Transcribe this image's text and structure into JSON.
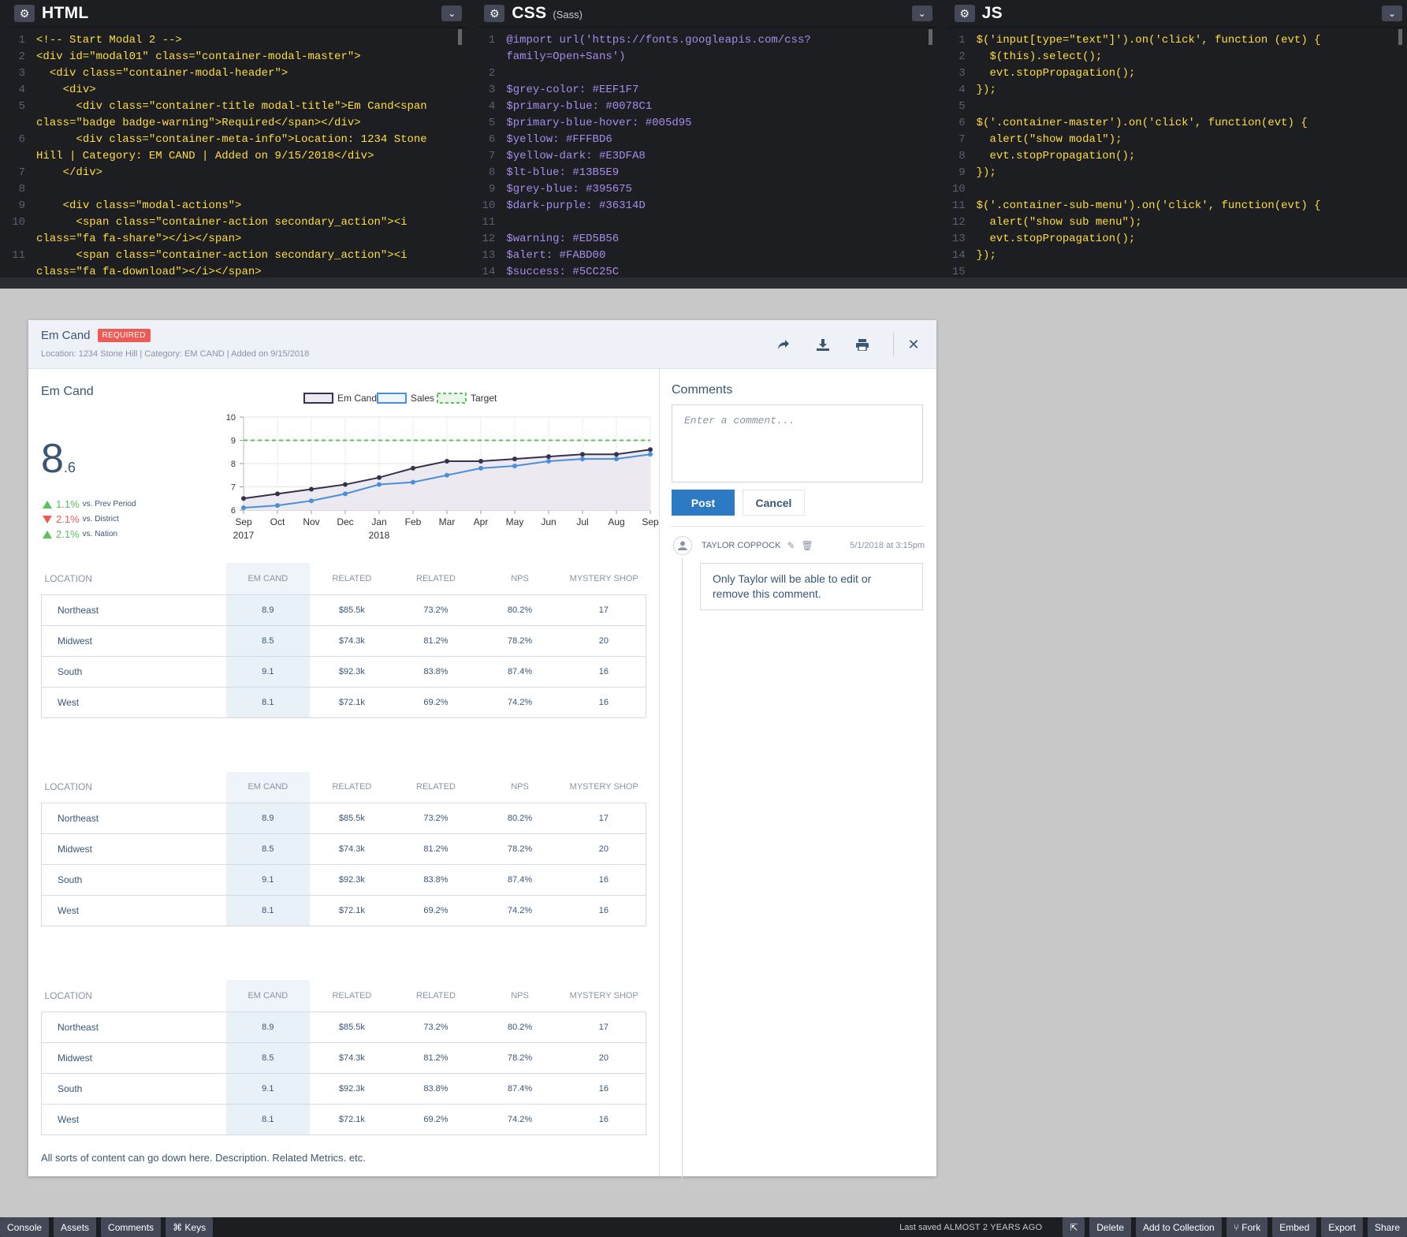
{
  "editors": {
    "html": {
      "title": "HTML",
      "lines": [
        {
          "n": "1",
          "text": "<!-- Start Modal 2 -->"
        },
        {
          "n": "2",
          "text": "<div id=\"modal01\" class=\"container-modal-master\">"
        },
        {
          "n": "3",
          "text": "  <div class=\"container-modal-header\">"
        },
        {
          "n": "4",
          "text": "    <div>"
        },
        {
          "n": "5",
          "text": "      <div class=\"container-title modal-title\">Em Cand<span class=\"badge badge-warning\">Required</span></div>"
        },
        {
          "n": "6",
          "text": "      <div class=\"container-meta-info\">Location: 1234 Stone Hill | Category: EM CAND | Added on 9/15/2018</div>"
        },
        {
          "n": "7",
          "text": "    </div>"
        },
        {
          "n": "8",
          "text": ""
        },
        {
          "n": "9",
          "text": "    <div class=\"modal-actions\">"
        },
        {
          "n": "10",
          "text": "      <span class=\"container-action secondary_action\"><i class=\"fa fa-share\"></i></span>"
        },
        {
          "n": "11",
          "text": "      <span class=\"container-action secondary_action\"><i class=\"fa fa-download\"></i></span>"
        }
      ]
    },
    "css": {
      "title": "CSS",
      "subtitle": "(Sass)",
      "lines": [
        {
          "n": "1",
          "text": "@import url('https://fonts.googleapis.com/css?family=Open+Sans')"
        },
        {
          "n": "2",
          "text": ""
        },
        {
          "n": "3",
          "text": "$grey-color: #EEF1F7"
        },
        {
          "n": "4",
          "text": "$primary-blue: #0078C1"
        },
        {
          "n": "5",
          "text": "$primary-blue-hover: #005d95"
        },
        {
          "n": "6",
          "text": "$yellow: #FFFBD6"
        },
        {
          "n": "7",
          "text": "$yellow-dark: #E3DFA8"
        },
        {
          "n": "8",
          "text": "$lt-blue: #13B5E9"
        },
        {
          "n": "9",
          "text": "$grey-blue: #395675"
        },
        {
          "n": "10",
          "text": "$dark-purple: #36314D"
        },
        {
          "n": "11",
          "text": ""
        },
        {
          "n": "12",
          "text": "$warning: #ED5B56"
        },
        {
          "n": "13",
          "text": "$alert: #FABD00"
        },
        {
          "n": "14",
          "text": "$success: #5CC25C"
        }
      ]
    },
    "js": {
      "title": "JS",
      "lines": [
        {
          "n": "1",
          "text": "$('input[type=\"text\"]').on('click', function (evt) {"
        },
        {
          "n": "2",
          "text": "  $(this).select();"
        },
        {
          "n": "3",
          "text": "  evt.stopPropagation();"
        },
        {
          "n": "4",
          "text": "});"
        },
        {
          "n": "5",
          "text": ""
        },
        {
          "n": "6",
          "text": "$('.container-master').on('click', function(evt) {"
        },
        {
          "n": "7",
          "text": "  alert(\"show modal\");"
        },
        {
          "n": "8",
          "text": "  evt.stopPropagation();"
        },
        {
          "n": "9",
          "text": "});"
        },
        {
          "n": "10",
          "text": ""
        },
        {
          "n": "11",
          "text": "$('.container-sub-menu').on('click', function(evt) {"
        },
        {
          "n": "12",
          "text": "  alert(\"show sub menu\");"
        },
        {
          "n": "13",
          "text": "  evt.stopPropagation();"
        },
        {
          "n": "14",
          "text": "});"
        },
        {
          "n": "15",
          "text": ""
        }
      ]
    }
  },
  "modal": {
    "title": "Em Cand",
    "badge": "REQUIRED",
    "meta": "Location: 1234 Stone Hill | Category: EM CAND | Added on 9/15/2018",
    "actions": [
      "share-icon",
      "download-icon",
      "print-icon",
      "close-icon"
    ],
    "metric": {
      "name": "Em Cand",
      "value_int": "8",
      "value_dec": ".6",
      "deltas": [
        {
          "dir": "up",
          "value": "1.1%",
          "label": "vs. Prev Period"
        },
        {
          "dir": "down",
          "value": "2.1%",
          "label": "vs. District"
        },
        {
          "dir": "up",
          "value": "2.1%",
          "label": "vs. Nation"
        }
      ]
    },
    "footer": "All sorts of content can go down here. Description. Related Metrics. etc."
  },
  "chart_data": {
    "type": "line",
    "categories": [
      "Sep",
      "Oct",
      "Nov",
      "Dec",
      "Jan",
      "Feb",
      "Mar",
      "Apr",
      "May",
      "Jun",
      "Jul",
      "Aug",
      "Sep"
    ],
    "category_sublabels": [
      "2017",
      "",
      "",
      "",
      "2018",
      "",
      "",
      "",
      "",
      "",
      "",
      "",
      ""
    ],
    "ylim": [
      6,
      10
    ],
    "yticks": [
      6,
      7,
      8,
      9,
      10
    ],
    "grid": true,
    "legend": "top-center",
    "series": [
      {
        "name": "Em Cand",
        "color": "#36314D",
        "fill": "#ece9f1",
        "values": [
          6.5,
          6.7,
          6.9,
          7.1,
          7.4,
          7.8,
          8.1,
          8.1,
          8.2,
          8.3,
          8.4,
          8.4,
          8.6
        ]
      },
      {
        "name": "Sales",
        "color": "#4a90d9",
        "values": [
          6.1,
          6.2,
          6.4,
          6.7,
          7.1,
          7.2,
          7.5,
          7.8,
          7.9,
          8.1,
          8.2,
          8.2,
          8.4
        ]
      },
      {
        "name": "Target",
        "color": "#5cc25c",
        "dashed": true,
        "values": [
          9,
          9,
          9,
          9,
          9,
          9,
          9,
          9,
          9,
          9,
          9,
          9,
          9
        ]
      }
    ]
  },
  "tables": [
    {
      "headers": [
        "LOCATION",
        "EM CAND",
        "RELATED",
        "RELATED",
        "NPS",
        "MYSTERY SHOP"
      ],
      "rows": [
        [
          "Northeast",
          "8.9",
          "$85.5k",
          "73.2%",
          "80.2%",
          "17"
        ],
        [
          "Midwest",
          "8.5",
          "$74.3k",
          "81.2%",
          "78.2%",
          "20"
        ],
        [
          "South",
          "9.1",
          "$92.3k",
          "83.8%",
          "87.4%",
          "16"
        ],
        [
          "West",
          "8.1",
          "$72.1k",
          "69.2%",
          "74.2%",
          "16"
        ]
      ]
    },
    {
      "headers": [
        "LOCATION",
        "EM CAND",
        "RELATED",
        "RELATED",
        "NPS",
        "MYSTERY SHOP"
      ],
      "rows": [
        [
          "Northeast",
          "8.9",
          "$85.5k",
          "73.2%",
          "80.2%",
          "17"
        ],
        [
          "Midwest",
          "8.5",
          "$74.3k",
          "81.2%",
          "78.2%",
          "20"
        ],
        [
          "South",
          "9.1",
          "$92.3k",
          "83.8%",
          "87.4%",
          "16"
        ],
        [
          "West",
          "8.1",
          "$72.1k",
          "69.2%",
          "74.2%",
          "16"
        ]
      ]
    },
    {
      "headers": [
        "LOCATION",
        "EM CAND",
        "RELATED",
        "RELATED",
        "NPS",
        "MYSTERY SHOP"
      ],
      "rows": [
        [
          "Northeast",
          "8.9",
          "$85.5k",
          "73.2%",
          "80.2%",
          "17"
        ],
        [
          "Midwest",
          "8.5",
          "$74.3k",
          "81.2%",
          "78.2%",
          "20"
        ],
        [
          "South",
          "9.1",
          "$92.3k",
          "83.8%",
          "87.4%",
          "16"
        ],
        [
          "West",
          "8.1",
          "$72.1k",
          "69.2%",
          "74.2%",
          "16"
        ]
      ]
    }
  ],
  "comments": {
    "title": "Comments",
    "placeholder": "Enter a comment...",
    "post_label": "Post",
    "cancel_label": "Cancel",
    "items": [
      {
        "author": "TAYLOR COPPOCK",
        "time": "5/1/2018 at 3:15pm",
        "text": "Only Taylor will be able to edit or remove this comment."
      }
    ]
  },
  "bottombar": {
    "left": [
      "Console",
      "Assets",
      "Comments",
      "⌘ Keys"
    ],
    "saved_prefix": "Last saved",
    "saved_when": "ALMOST 2 YEARS AGO",
    "right": [
      "Delete",
      "Add to Collection",
      "Fork",
      "Embed",
      "Export",
      "Share"
    ]
  }
}
